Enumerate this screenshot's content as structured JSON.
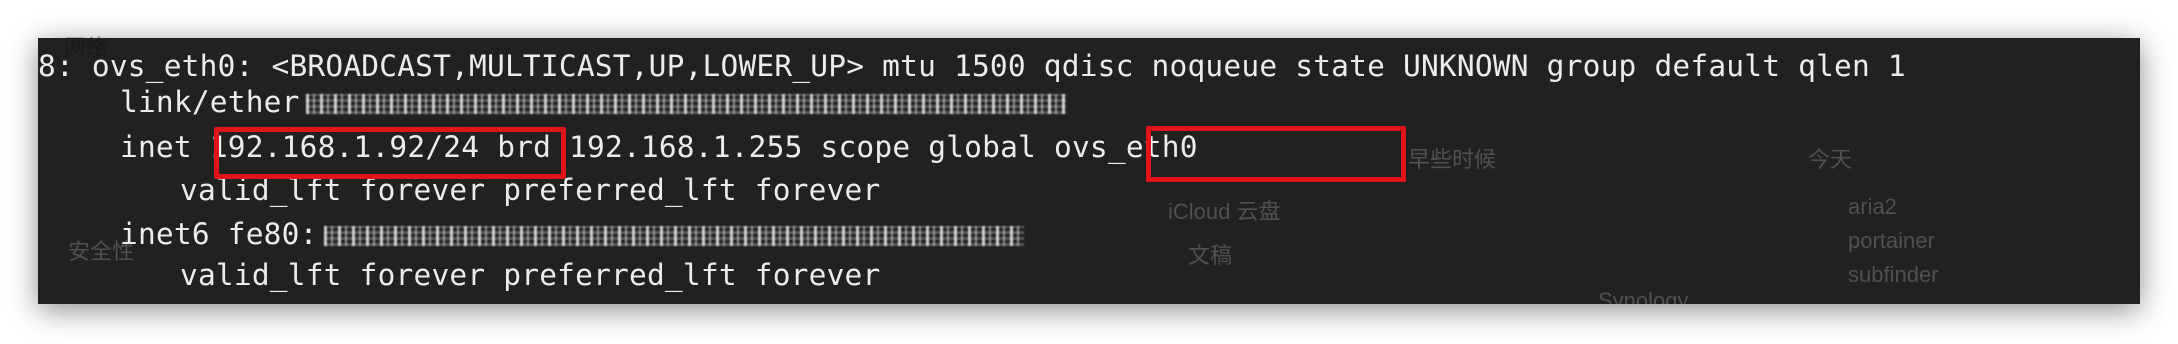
{
  "desktop": {
    "ghost_labels": [
      "网络",
      "文稿",
      "今天",
      "早些时候",
      "iCloud 云盘",
      "aria2",
      "portainer",
      "subfinder",
      "Synology",
      "安全性"
    ]
  },
  "terminal": {
    "background": "#101010",
    "text_color": "#ececec",
    "lines": {
      "line1": "8: ovs_eth0: <BROADCAST,MULTICAST,UP,LOWER_UP> mtu 1500 qdisc noqueue state UNKNOWN group default qlen 1",
      "line2_prefix": "link/ether",
      "line3_prefix": "inet ",
      "line3_ip": "192.168.1.92/24",
      "line3_middle": " brd 192.168.1.255 scope global ",
      "line3_iface": "ovs_eth0",
      "line4": "valid_lft forever preferred_lft forever",
      "line5_prefix": "inet6 fe80:",
      "line6": "valid_lft forever preferred_lft forever"
    }
  },
  "annotations": {
    "highlight_color": "#e0151a"
  }
}
